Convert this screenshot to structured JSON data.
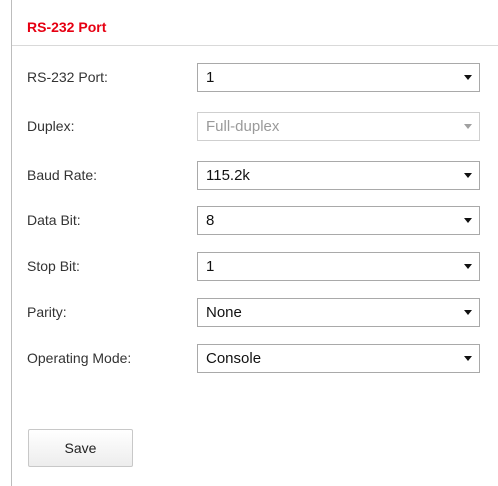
{
  "section": {
    "title": "RS-232 Port"
  },
  "form": {
    "rs232_port": {
      "label": "RS-232 Port:",
      "value": "1",
      "disabled": false
    },
    "duplex": {
      "label": "Duplex:",
      "value": "Full-duplex",
      "disabled": true
    },
    "baud_rate": {
      "label": "Baud Rate:",
      "value": "115.2k",
      "disabled": false
    },
    "data_bit": {
      "label": "Data Bit:",
      "value": "8",
      "disabled": false
    },
    "stop_bit": {
      "label": "Stop Bit:",
      "value": "1",
      "disabled": false
    },
    "parity": {
      "label": "Parity:",
      "value": "None",
      "disabled": false
    },
    "operating_mode": {
      "label": "Operating Mode:",
      "value": "Console",
      "disabled": false
    }
  },
  "actions": {
    "save_label": "Save"
  },
  "colors": {
    "title_red": "#e60012",
    "disabled_text": "#9a9a9a"
  }
}
